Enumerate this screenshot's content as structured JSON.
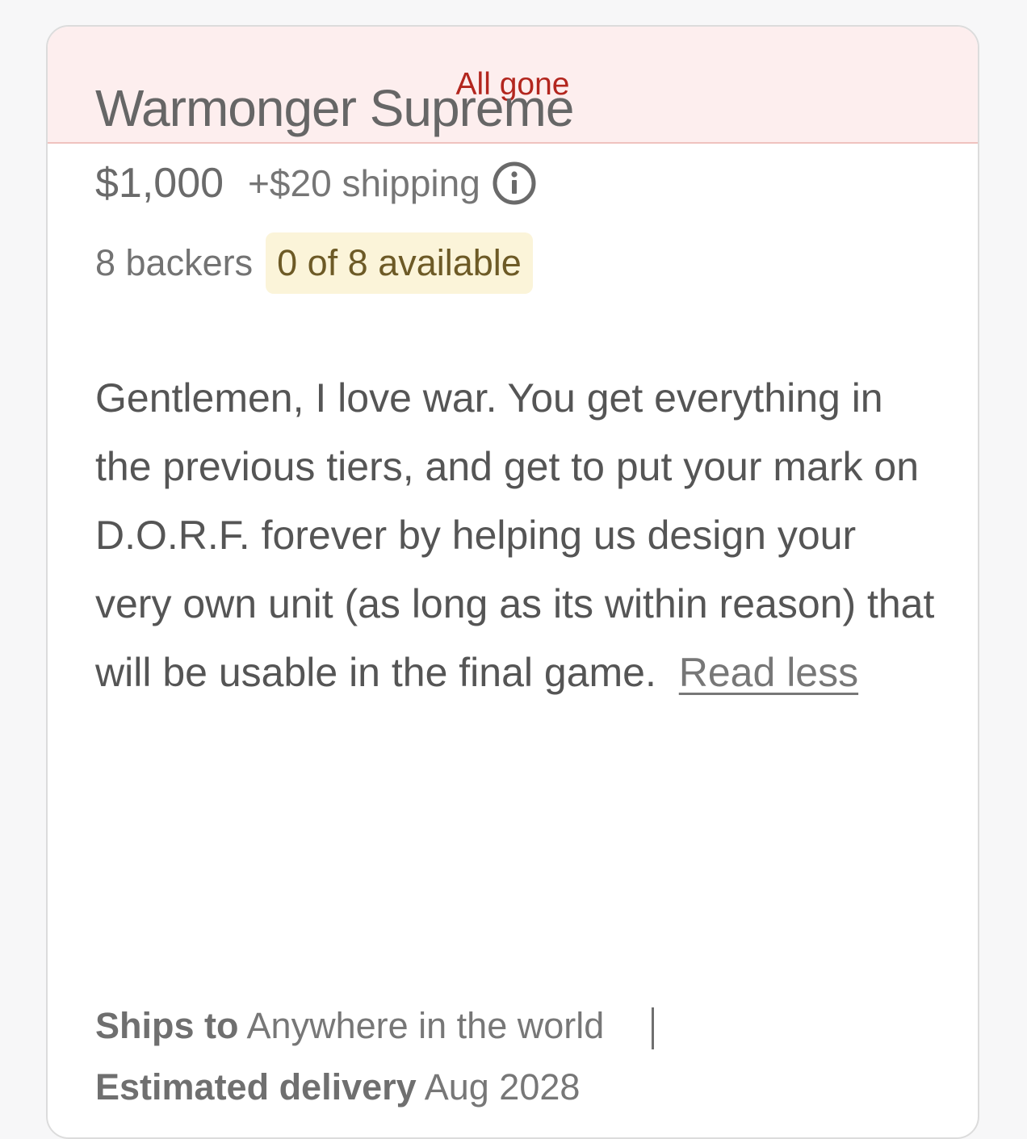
{
  "status_banner": "All gone",
  "reward": {
    "title": "Warmonger Supreme",
    "price": "$1,000",
    "shipping": "+$20 shipping",
    "backers": "8 backers",
    "availability": "0 of 8 available",
    "description": "Gentlemen, I love war. You get everything in the previous tiers, and get to put your mark on D.O.R.F. forever by helping us design your very own unit (as long as its within reason) that will be usable in the final game.",
    "read_less_label": "Read less",
    "ships_to_label": "Ships to",
    "ships_to_value": "Anywhere in the world",
    "delivery_label": "Estimated delivery",
    "delivery_value": "Aug 2028"
  },
  "colors": {
    "banner_bg": "#fdeeee",
    "banner_text": "#b3261e",
    "availability_bg": "#fbf4d9",
    "availability_text": "#6d5a26"
  },
  "icons": {
    "shipping_info": "info-circle-icon"
  }
}
